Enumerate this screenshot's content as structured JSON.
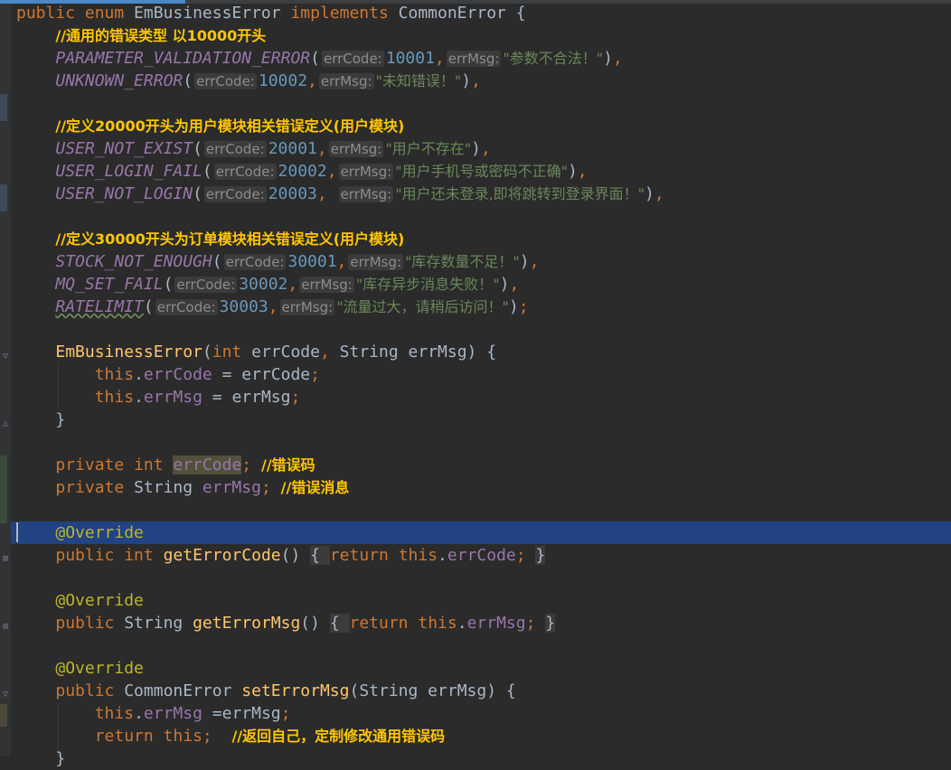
{
  "editor": {
    "lines": [
      {
        "t": [
          [
            "kw",
            "public "
          ],
          [
            "kw",
            "enum "
          ],
          [
            "cls",
            "EmBusinessError "
          ],
          [
            "kw",
            "implements "
          ],
          [
            "cls",
            "CommonError "
          ],
          [
            "txt",
            "{"
          ]
        ]
      },
      {
        "t": [
          [
            "ind",
            "    "
          ],
          [
            "cmt",
            "//通用的错误类型 以10000开头"
          ]
        ]
      },
      {
        "t": [
          [
            "ind",
            "    "
          ],
          [
            "cst",
            "PARAMETER_VALIDATION_ERROR"
          ],
          [
            "txt",
            "("
          ],
          [
            "hint",
            "errCode:"
          ],
          [
            "num",
            "10001"
          ],
          [
            "kw",
            ","
          ],
          [
            "hint",
            "errMsg:"
          ],
          [
            "str",
            "\"参数不合法！\""
          ],
          [
            "txt",
            ")"
          ],
          [
            "kw",
            ","
          ]
        ]
      },
      {
        "t": [
          [
            "ind",
            "    "
          ],
          [
            "cst",
            "UNKNOWN_ERROR"
          ],
          [
            "txt",
            "("
          ],
          [
            "hint",
            "errCode:"
          ],
          [
            "num",
            "10002"
          ],
          [
            "kw",
            ","
          ],
          [
            "hint",
            "errMsg:"
          ],
          [
            "str",
            "\"未知错误！\""
          ],
          [
            "txt",
            ")"
          ],
          [
            "kw",
            ","
          ]
        ]
      },
      {
        "t": []
      },
      {
        "t": [
          [
            "ind",
            "    "
          ],
          [
            "cmt",
            "//定义20000开头为用户模块相关错误定义(用户模块)"
          ]
        ]
      },
      {
        "t": [
          [
            "ind",
            "    "
          ],
          [
            "cst",
            "USER_NOT_EXIST"
          ],
          [
            "txt",
            "("
          ],
          [
            "hint",
            "errCode:"
          ],
          [
            "num",
            "20001"
          ],
          [
            "kw",
            ","
          ],
          [
            "hint",
            "errMsg:"
          ],
          [
            "str",
            "\"用户不存在\""
          ],
          [
            "txt",
            ")"
          ],
          [
            "kw",
            ","
          ]
        ]
      },
      {
        "t": [
          [
            "ind",
            "    "
          ],
          [
            "cst",
            "USER_LOGIN_FAIL"
          ],
          [
            "txt",
            "("
          ],
          [
            "hint",
            "errCode:"
          ],
          [
            "num",
            "20002"
          ],
          [
            "kw",
            ","
          ],
          [
            "hint",
            "errMsg:"
          ],
          [
            "str",
            "\"用户手机号或密码不正确\""
          ],
          [
            "txt",
            ")"
          ],
          [
            "kw",
            ","
          ]
        ]
      },
      {
        "t": [
          [
            "ind",
            "    "
          ],
          [
            "cst",
            "USER_NOT_LOGIN"
          ],
          [
            "txt",
            "("
          ],
          [
            "hint",
            "errCode:"
          ],
          [
            "num",
            "20003"
          ],
          [
            "kw",
            ", "
          ],
          [
            "hint",
            "errMsg:"
          ],
          [
            "str",
            "\"用户还未登录,即将跳转到登录界面！\""
          ],
          [
            "txt",
            ")"
          ],
          [
            "kw",
            ","
          ]
        ]
      },
      {
        "t": []
      },
      {
        "t": [
          [
            "ind",
            "    "
          ],
          [
            "cmt",
            "//定义30000开头为订单模块相关错误定义(用户模块)"
          ]
        ]
      },
      {
        "t": [
          [
            "ind",
            "    "
          ],
          [
            "cst",
            "STOCK_NOT_ENOUGH"
          ],
          [
            "txt",
            "("
          ],
          [
            "hint",
            "errCode:"
          ],
          [
            "num",
            "30001"
          ],
          [
            "kw",
            ","
          ],
          [
            "hint",
            "errMsg:"
          ],
          [
            "str",
            "\"库存数量不足！\""
          ],
          [
            "txt",
            ")"
          ],
          [
            "kw",
            ","
          ]
        ]
      },
      {
        "t": [
          [
            "ind",
            "    "
          ],
          [
            "cst",
            "MQ_SET_FAIL"
          ],
          [
            "txt",
            "("
          ],
          [
            "hint",
            "errCode:"
          ],
          [
            "num",
            "30002"
          ],
          [
            "kw",
            ","
          ],
          [
            "hint",
            "errMsg:"
          ],
          [
            "str",
            "\"库存异步消息失败！\""
          ],
          [
            "txt",
            ")"
          ],
          [
            "kw",
            ","
          ]
        ]
      },
      {
        "t": [
          [
            "ind",
            "    "
          ],
          [
            "csq",
            "RATELIMIT"
          ],
          [
            "txt",
            "("
          ],
          [
            "hint",
            "errCode:"
          ],
          [
            "num",
            "30003"
          ],
          [
            "kw",
            ","
          ],
          [
            "hint",
            "errMsg:"
          ],
          [
            "str",
            "\"流量过大，请稍后访问！\""
          ],
          [
            "txt",
            ")"
          ],
          [
            "kw",
            ";"
          ]
        ]
      },
      {
        "t": []
      },
      {
        "t": [
          [
            "ind",
            "    "
          ],
          [
            "fn",
            "EmBusinessError"
          ],
          [
            "txt",
            "("
          ],
          [
            "kw",
            "int "
          ],
          [
            "txt",
            "errCode"
          ],
          [
            "kw",
            ", "
          ],
          [
            "txt",
            "String errMsg) {"
          ]
        ]
      },
      {
        "t": [
          [
            "ind",
            "        "
          ],
          [
            "kw",
            "this"
          ],
          [
            "txt",
            "."
          ],
          [
            "fld",
            "errCode"
          ],
          [
            "txt",
            " = errCode"
          ],
          [
            "kw",
            ";"
          ]
        ]
      },
      {
        "t": [
          [
            "ind",
            "        "
          ],
          [
            "kw",
            "this"
          ],
          [
            "txt",
            "."
          ],
          [
            "fld",
            "errMsg"
          ],
          [
            "txt",
            " = errMsg"
          ],
          [
            "kw",
            ";"
          ]
        ]
      },
      {
        "t": [
          [
            "ind",
            "    "
          ],
          [
            "txt",
            "}"
          ]
        ]
      },
      {
        "t": []
      },
      {
        "t": [
          [
            "ind",
            "    "
          ],
          [
            "kw",
            "private "
          ],
          [
            "kw",
            "int "
          ],
          [
            "fhl",
            "errCode"
          ],
          [
            "kw",
            "; "
          ],
          [
            "cmt",
            "//错误码"
          ]
        ]
      },
      {
        "t": [
          [
            "ind",
            "    "
          ],
          [
            "kw",
            "private "
          ],
          [
            "txt",
            "String "
          ],
          [
            "fld",
            "errMsg"
          ],
          [
            "kw",
            "; "
          ],
          [
            "cmt",
            "//错误消息"
          ]
        ]
      },
      {
        "t": []
      },
      {
        "t": [
          [
            "ind",
            "    "
          ],
          [
            "ann",
            "@Override"
          ]
        ]
      },
      {
        "t": [
          [
            "ind",
            "    "
          ],
          [
            "kw",
            "public "
          ],
          [
            "kw",
            "int "
          ],
          [
            "fn",
            "getErrorCode"
          ],
          [
            "txt",
            "() "
          ],
          [
            "br",
            "{ "
          ],
          [
            "kw",
            "return "
          ],
          [
            "kw",
            "this"
          ],
          [
            "txt",
            "."
          ],
          [
            "fld",
            "errCode"
          ],
          [
            "kw",
            "; "
          ],
          [
            "br",
            "}"
          ]
        ]
      },
      {
        "t": []
      },
      {
        "t": [
          [
            "ind",
            "    "
          ],
          [
            "ann",
            "@Override"
          ]
        ]
      },
      {
        "t": [
          [
            "ind",
            "    "
          ],
          [
            "kw",
            "public "
          ],
          [
            "txt",
            "String "
          ],
          [
            "fn",
            "getErrorMsg"
          ],
          [
            "txt",
            "() "
          ],
          [
            "br",
            "{ "
          ],
          [
            "kw",
            "return "
          ],
          [
            "kw",
            "this"
          ],
          [
            "txt",
            "."
          ],
          [
            "fld",
            "errMsg"
          ],
          [
            "kw",
            "; "
          ],
          [
            "br",
            "}"
          ]
        ]
      },
      {
        "t": []
      },
      {
        "t": [
          [
            "ind",
            "    "
          ],
          [
            "ann",
            "@Override"
          ]
        ]
      },
      {
        "t": [
          [
            "ind",
            "    "
          ],
          [
            "kw",
            "public "
          ],
          [
            "txt",
            "CommonError "
          ],
          [
            "fn",
            "setErrorMsg"
          ],
          [
            "txt",
            "(String errMsg) {"
          ]
        ]
      },
      {
        "t": [
          [
            "ind",
            "        "
          ],
          [
            "kw",
            "this"
          ],
          [
            "txt",
            "."
          ],
          [
            "fld",
            "errMsg"
          ],
          [
            "txt",
            " =errMsg"
          ],
          [
            "kw",
            ";"
          ]
        ]
      },
      {
        "t": [
          [
            "ind",
            "        "
          ],
          [
            "kw",
            "return "
          ],
          [
            "kw",
            "this"
          ],
          [
            "kw",
            ";  "
          ],
          [
            "cmt",
            "//返回自己，定制修改通用错误码"
          ]
        ]
      },
      {
        "t": [
          [
            "ind",
            "    "
          ],
          [
            "txt",
            "}"
          ]
        ]
      }
    ]
  },
  "colors": {
    "background": "#2b2b2b",
    "keyword": "#cc7832",
    "constant": "#9876aa",
    "number": "#6897bb",
    "string": "#6a8759",
    "comment": "#ffc600",
    "annotation": "#bbb529",
    "method": "#ffc66d",
    "caret_line": "#214283"
  },
  "icons": [
    "fold-marker-icon",
    "text-caret-icon"
  ]
}
